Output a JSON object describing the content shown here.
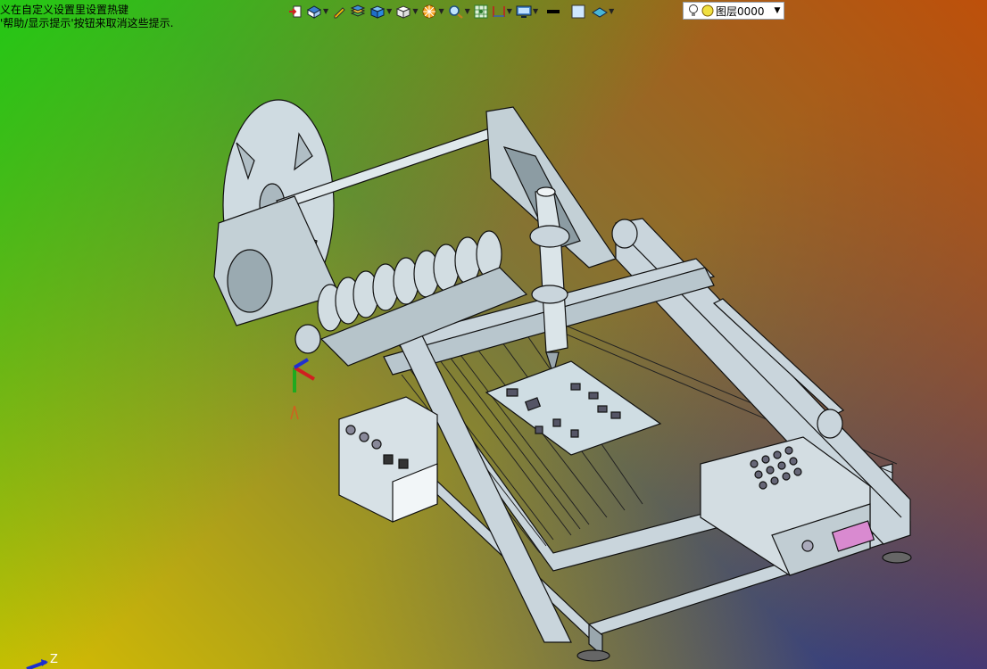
{
  "hints": {
    "line1": "义在自定义设置里设置热键",
    "line2": "'帮助/显示提示'按钮来取消这些提示."
  },
  "toolbar": {
    "items": [
      {
        "icon": "import-export-icon",
        "dropdown": false
      },
      {
        "icon": "view-orientation-icon",
        "dropdown": true
      },
      {
        "icon": "sketch-pencil-icon",
        "dropdown": false
      },
      {
        "icon": "layers-stack-icon",
        "dropdown": false
      },
      {
        "icon": "shaded-cube-icon",
        "dropdown": true
      },
      {
        "icon": "wireframe-cube-icon",
        "dropdown": true
      },
      {
        "icon": "section-view-icon",
        "dropdown": true
      },
      {
        "icon": "zoom-icon",
        "dropdown": true
      },
      {
        "icon": "grid-snap-icon",
        "dropdown": false
      },
      {
        "icon": "dimension-icon",
        "dropdown": true
      },
      {
        "icon": "display-settings-icon",
        "dropdown": true
      },
      {
        "icon": "line-color-icon",
        "dropdown": false
      },
      {
        "icon": "fill-color-icon",
        "dropdown": false
      },
      {
        "icon": "plane-icon",
        "dropdown": true
      }
    ]
  },
  "layer": {
    "name": "图层0000"
  },
  "axis": {
    "z_label": "Z"
  },
  "colors": {
    "background_tl": "#23c814",
    "background_tr": "#be500a",
    "background_bl": "#d7be00",
    "background_br": "#28328c",
    "model": "#c9d5dc",
    "edge": "#1a1a1a"
  }
}
